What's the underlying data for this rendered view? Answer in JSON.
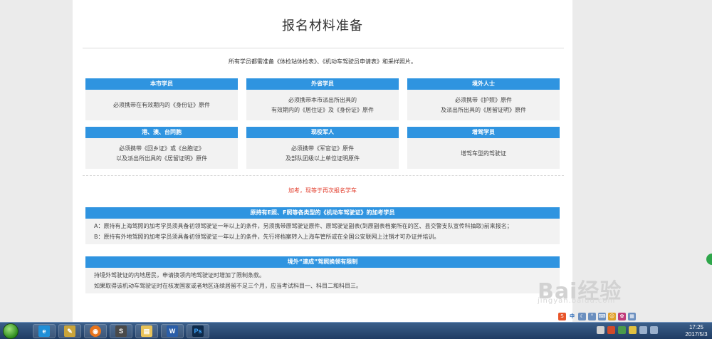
{
  "page": {
    "title": "报名材料准备",
    "intro": "所有学员都需准备《体检站体检表》、《机动车驾驶员申请表》和采样照片。"
  },
  "cards": [
    {
      "head": "本市学员",
      "lines": [
        "必须携带在有效期内的《身份证》原件"
      ]
    },
    {
      "head": "外省学员",
      "lines": [
        "必须携带本市派出所出具的",
        "有效期内的《居住证》及《身份证》原件"
      ]
    },
    {
      "head": "境外人士",
      "lines": [
        "必须携带《护照》原件",
        "及派出所出具的《居留证明》原件"
      ]
    },
    {
      "head": "港、澳、台同胞",
      "lines": [
        "必须携带《回乡证》或《台胞证》",
        "以及派出所出具的《居留证明》原件"
      ]
    },
    {
      "head": "现役军人",
      "lines": [
        "必须携带《军官证》原件",
        "及部队团级以上单位证明原件"
      ]
    },
    {
      "head": "增驾学员",
      "lines": [
        "增驾车型的驾驶证"
      ]
    }
  ],
  "notice": "加考，现等于再次报名学车",
  "sections": [
    {
      "head": "原持有E照、F照等各类型的《机动车驾驶证》的加考学员",
      "lines": [
        "A：原持有上海驾照的加考学员须具备初领驾驶证一年以上的条件，另须携带原驾驶证原件、原驾驶证副表(到原副表档案所在的区、县交警支队宣传科抽取)前来报名；",
        "B：原持有外地驾照的加考学员须具备初领驾驶证一年以上的条件，先行将档案转入上海车管所或在全国公安联网上注销才可办证并培训。"
      ]
    },
    {
      "head": "境外“速成”驾照换领有限制",
      "lines": [
        "持境外驾驶证的内地居民，申请换领内地驾驶证时增加了限制条款。",
        "如果取得该机动车驾驶证时在核发国家或者地区连续居留不足三个月，应当考试科目一、科目二和科目三。"
      ]
    }
  ],
  "watermark": {
    "brand": "Bai经验",
    "url": "jingyan.baidu.com"
  },
  "ime_bar": {
    "icons": [
      "ime-s-icon",
      "ime-chinese-icon",
      "ime-moon-icon",
      "ime-punct-icon",
      "ime-keyboard-icon",
      "ime-user-icon",
      "ime-skin-icon",
      "ime-tools-icon"
    ],
    "mode_label": "中"
  },
  "taskbar": {
    "apps": [
      {
        "name": "ie",
        "glyph": "e",
        "color": "#1f8fd8"
      },
      {
        "name": "tool",
        "glyph": "✎",
        "color": "#c9a43a"
      },
      {
        "name": "firefox",
        "glyph": "◉",
        "color": "#e8741c"
      },
      {
        "name": "sublime",
        "glyph": "S",
        "color": "#4a4a4a"
      },
      {
        "name": "explorer",
        "glyph": "▤",
        "color": "#e8c35a"
      },
      {
        "name": "word",
        "glyph": "W",
        "color": "#2b5ea8"
      },
      {
        "name": "photoshop",
        "glyph": "Ps",
        "color": "#0e2a4a"
      }
    ],
    "clock_time": "17:25",
    "clock_date": "2017/5/3"
  },
  "colors": {
    "accent": "#2f94e0",
    "notice": "#e23b2a"
  }
}
